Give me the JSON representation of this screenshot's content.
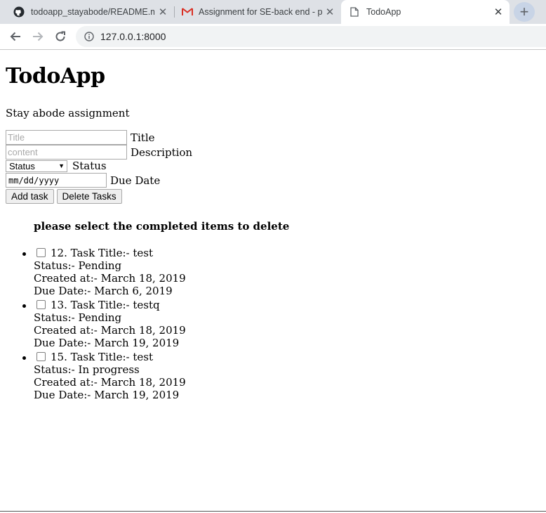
{
  "browser": {
    "tabs": [
      {
        "label": "todoapp_stayabode/README.md",
        "icon": "github-icon"
      },
      {
        "label": "Assignment for SE-back end - pa",
        "icon": "gmail-icon"
      },
      {
        "label": "TodoApp",
        "icon": "page-icon"
      }
    ],
    "new_tab_label": "+",
    "url": "127.0.0.1:8000"
  },
  "page": {
    "title": "TodoApp",
    "subtitle": "Stay abode assignment",
    "form": {
      "title_placeholder": "Title",
      "title_label": "Title",
      "content_placeholder": "content",
      "description_label": "Description",
      "status_selected": "Status",
      "status_label": "Status",
      "date_placeholder": "mm/dd/yyyy",
      "date_label": "Due Date",
      "add_button": "Add task",
      "delete_button": "Delete Tasks"
    },
    "instruction": "please select the completed items to delete",
    "tasks": [
      {
        "title_line": "12. Task Title:- test",
        "status": "Status:- Pending",
        "created": "Created at:- March 18, 2019",
        "due": "Due Date:- March 6, 2019"
      },
      {
        "title_line": "13. Task Title:- testq",
        "status": "Status:- Pending",
        "created": "Created at:- March 18, 2019",
        "due": "Due Date:- March 19, 2019"
      },
      {
        "title_line": "15. Task Title:- test",
        "status": "Status:- In progress",
        "created": "Created at:- March 18, 2019",
        "due": "Due Date:- March 19, 2019"
      }
    ]
  }
}
